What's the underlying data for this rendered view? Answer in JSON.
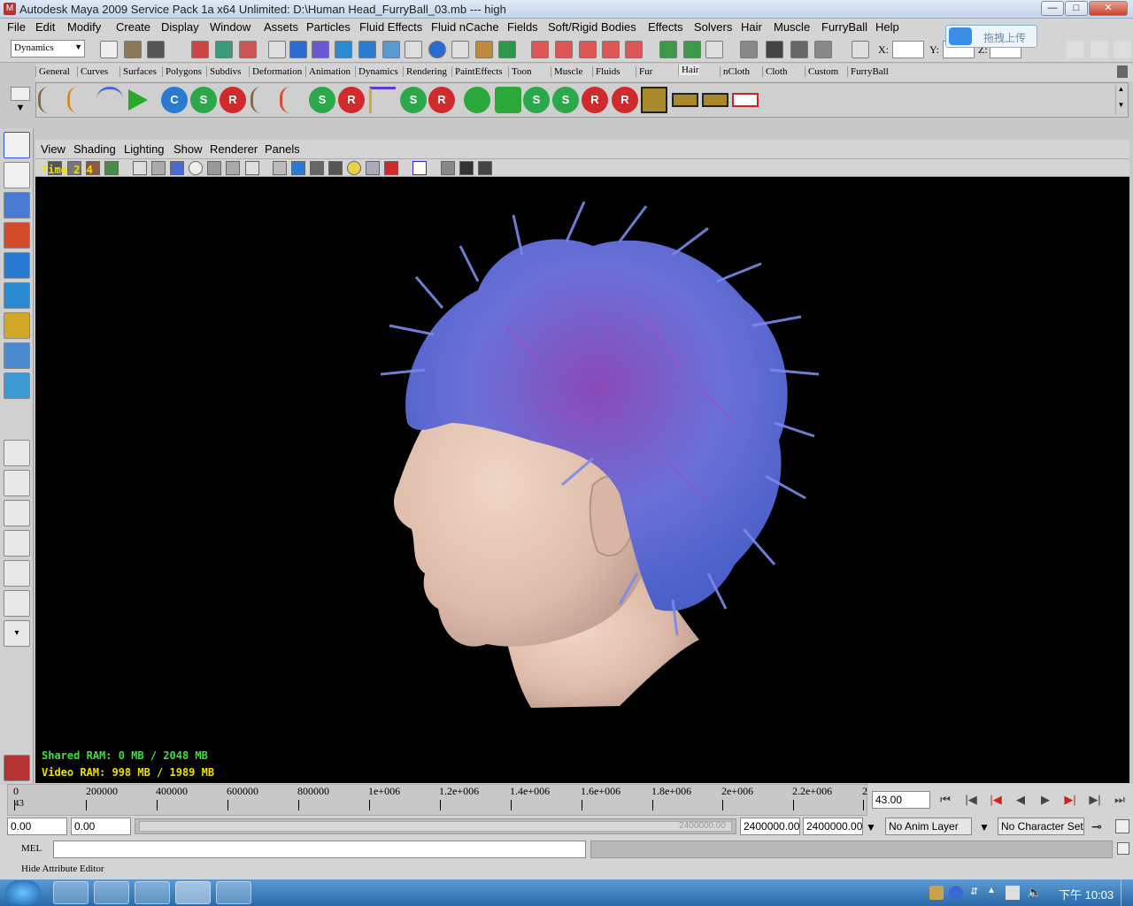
{
  "title": "Autodesk Maya 2009 Service Pack 1a x64 Unlimited: D:\\Human Head_FurryBall_03.mb  ---  high",
  "window_buttons": {
    "minimize": "—",
    "maximize": "□",
    "close": "✕"
  },
  "menu": [
    "File",
    "Edit",
    "Modify",
    "Create",
    "Display",
    "Window",
    "Assets",
    "Particles",
    "Fluid Effects",
    "Fluid nCache",
    "Fields",
    "Soft/Rigid Bodies",
    "Effects",
    "Solvers",
    "Hair",
    "Muscle",
    "FurryBall",
    "Help"
  ],
  "status": {
    "module": "Dynamics",
    "x_label": "X:",
    "y_label": "Y:",
    "z_label": "Z:",
    "upload_label": "拖拽上传"
  },
  "shelf_tabs": [
    "General",
    "Curves",
    "Surfaces",
    "Polygons",
    "Subdivs",
    "Deformation",
    "Animation",
    "Dynamics",
    "Rendering",
    "PaintEffects",
    "Toon",
    "Muscle",
    "Fluids",
    "Fur",
    "Hair",
    "nCloth",
    "Cloth",
    "Custom",
    "FurryBall"
  ],
  "panel_menu": [
    "View",
    "Shading",
    "Lighting",
    "Show",
    "Renderer",
    "Panels"
  ],
  "hud": {
    "time": "Time 2.4",
    "shared_ram": "Shared RAM: 0 MB / 2048 MB",
    "video_ram": "Video RAM: 998 MB / 1989 MB"
  },
  "timeline": {
    "labels": [
      "0",
      "200000",
      "400000",
      "600000",
      "800000",
      "1e+006",
      "1.2e+006",
      "1.4e+006",
      "1.6e+006",
      "1.8e+006",
      "2e+006",
      "2.2e+006",
      "2"
    ],
    "current_marker": "43",
    "current_frame": "43.00"
  },
  "range": {
    "start": "0.00",
    "anim_start": "0.00",
    "slider_end_hint": "2400000.00",
    "end": "2400000.00",
    "anim_end": "2400000.00",
    "anim_layer": "No Anim Layer",
    "character_set": "No Character Set"
  },
  "command": {
    "label": "MEL"
  },
  "help_line": "Hide Attribute Editor",
  "tray": {
    "clock": "下午 10:03"
  },
  "colors": {
    "viewport_bg": "#000000",
    "hud_yellow": "#f0e000",
    "hud_green": "#39e23a",
    "hair_blue": "#6a7fe0",
    "hair_purple": "#8a4ab8",
    "skin": "#e8c9b8"
  }
}
